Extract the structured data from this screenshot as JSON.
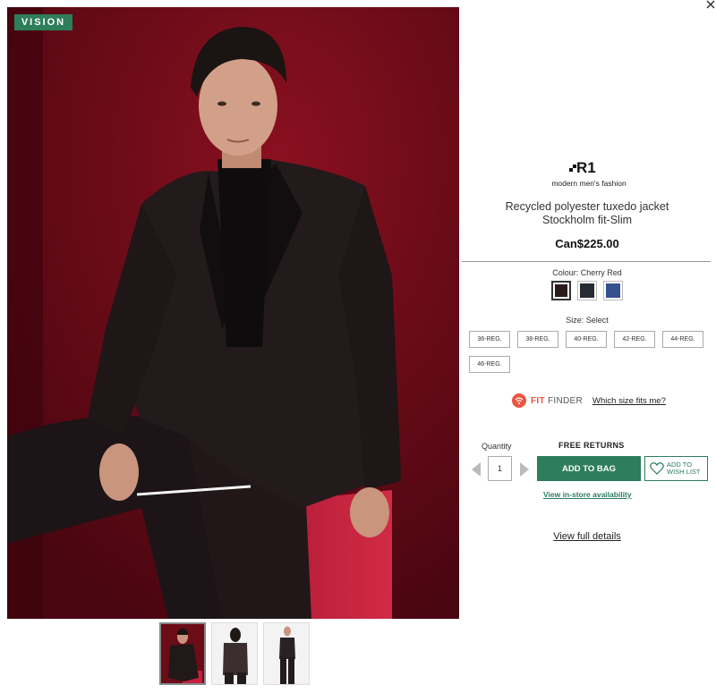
{
  "badge": {
    "label": "VISION"
  },
  "colors": {
    "accent": "#2e7d5b",
    "fit_finder": "#e9553f",
    "hero_bg": "#5a0a12"
  },
  "brand": {
    "logo_text": "R1",
    "tagline": "modern men's fashion"
  },
  "product": {
    "name_line1": "Recycled polyester tuxedo jacket",
    "name_line2": "Stockholm fit-Slim",
    "price": "Can$225.00"
  },
  "colour": {
    "label": "Colour: Cherry Red",
    "swatches": [
      {
        "name": "Cherry Red",
        "color": "#2a1a1a",
        "selected": true
      },
      {
        "name": "Black",
        "color": "#262a33",
        "selected": false
      },
      {
        "name": "Blue",
        "color": "#34508f",
        "selected": false
      }
    ]
  },
  "size": {
    "label": "Size: Select",
    "options": [
      "36-REG.",
      "38-REG.",
      "40-REG.",
      "42-REG.",
      "44-REG.",
      "46-REG."
    ]
  },
  "fit_finder": {
    "fit": "FIT",
    "finder": "FINDER",
    "link": "Which size fits me?"
  },
  "purchase": {
    "quantity_label": "Quantity",
    "quantity_value": "1",
    "free_returns": "FREE RETURNS",
    "add_to_bag": "ADD TO BAG",
    "wishlist_line1": "ADD TO",
    "wishlist_line2": "WISH LIST",
    "instore": "View in-store availability"
  },
  "details_link": "View full details",
  "thumbnails": [
    {
      "icon": "front-view",
      "active": true
    },
    {
      "icon": "back-view",
      "active": false
    },
    {
      "icon": "full-length-view",
      "active": false
    }
  ]
}
